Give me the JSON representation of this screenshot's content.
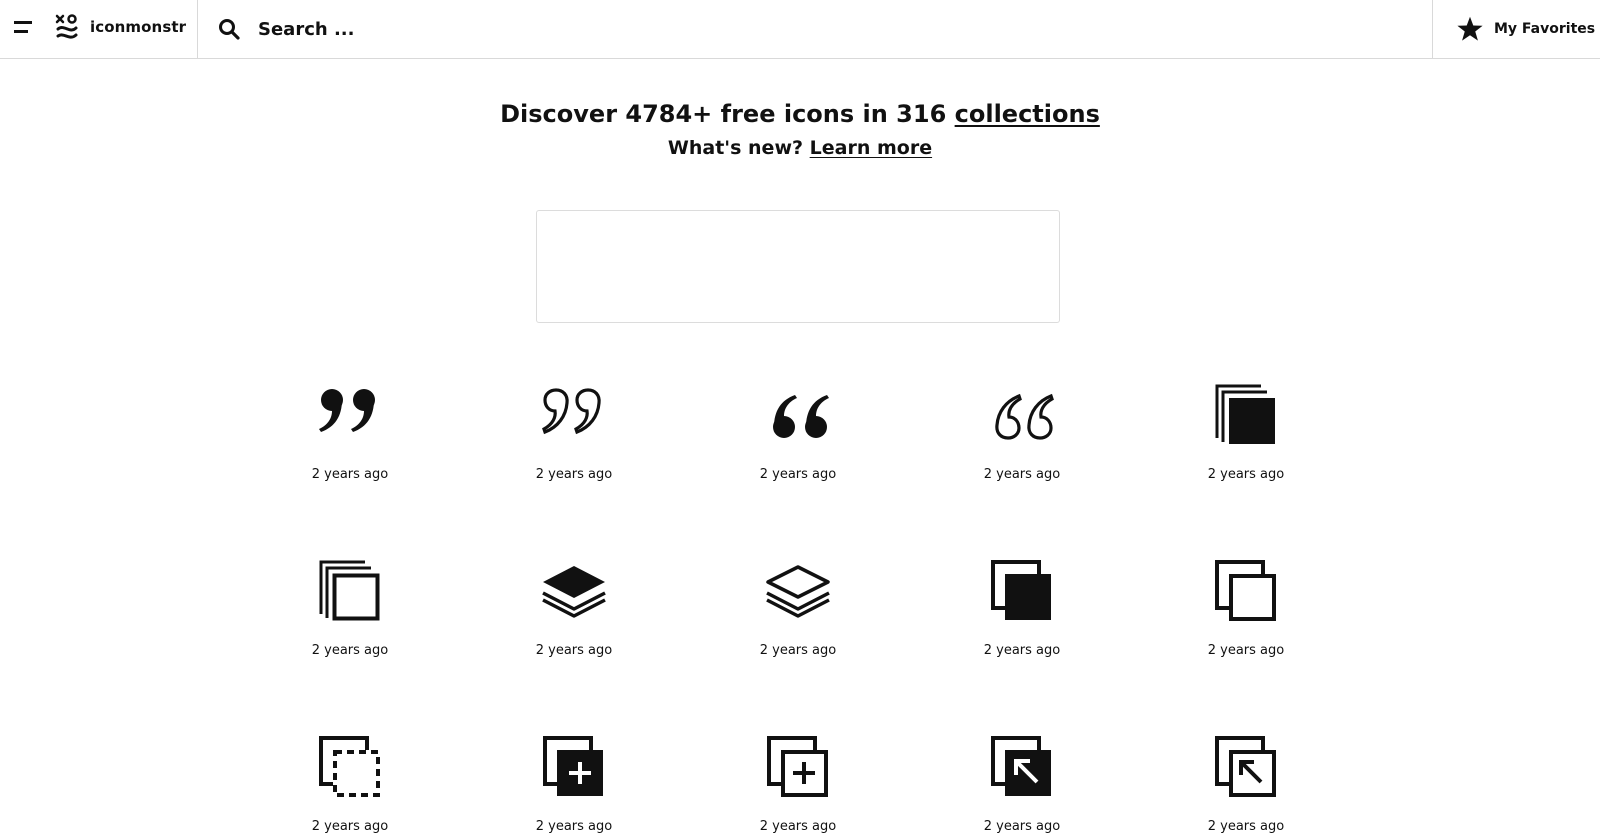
{
  "header": {
    "brand_name": "iconmonstr",
    "search_placeholder": "Search ...",
    "favorites_label": "My Favorites"
  },
  "hero": {
    "title_prefix": "Discover 4784+ free icons in 316 ",
    "title_link": "collections",
    "subtitle_prefix": "What's new? ",
    "subtitle_link": "Learn more"
  },
  "icons": [
    {
      "name": "quote-close-filled-icon",
      "time": "2 years ago"
    },
    {
      "name": "quote-close-outline-icon",
      "time": "2 years ago"
    },
    {
      "name": "quote-open-filled-icon",
      "time": "2 years ago"
    },
    {
      "name": "quote-open-outline-icon",
      "time": "2 years ago"
    },
    {
      "name": "stacked-squares-filled-icon",
      "time": "2 years ago"
    },
    {
      "name": "stacked-squares-outline-icon",
      "time": "2 years ago"
    },
    {
      "name": "layers-filled-icon",
      "time": "2 years ago"
    },
    {
      "name": "layers-outline-icon",
      "time": "2 years ago"
    },
    {
      "name": "copy-filled-icon",
      "time": "2 years ago"
    },
    {
      "name": "copy-outline-icon",
      "time": "2 years ago"
    },
    {
      "name": "copy-dashed-icon",
      "time": "2 years ago"
    },
    {
      "name": "copy-add-filled-icon",
      "time": "2 years ago"
    },
    {
      "name": "copy-add-outline-icon",
      "time": "2 years ago"
    },
    {
      "name": "copy-arrow-filled-icon",
      "time": "2 years ago"
    },
    {
      "name": "copy-arrow-outline-icon",
      "time": "2 years ago"
    }
  ]
}
